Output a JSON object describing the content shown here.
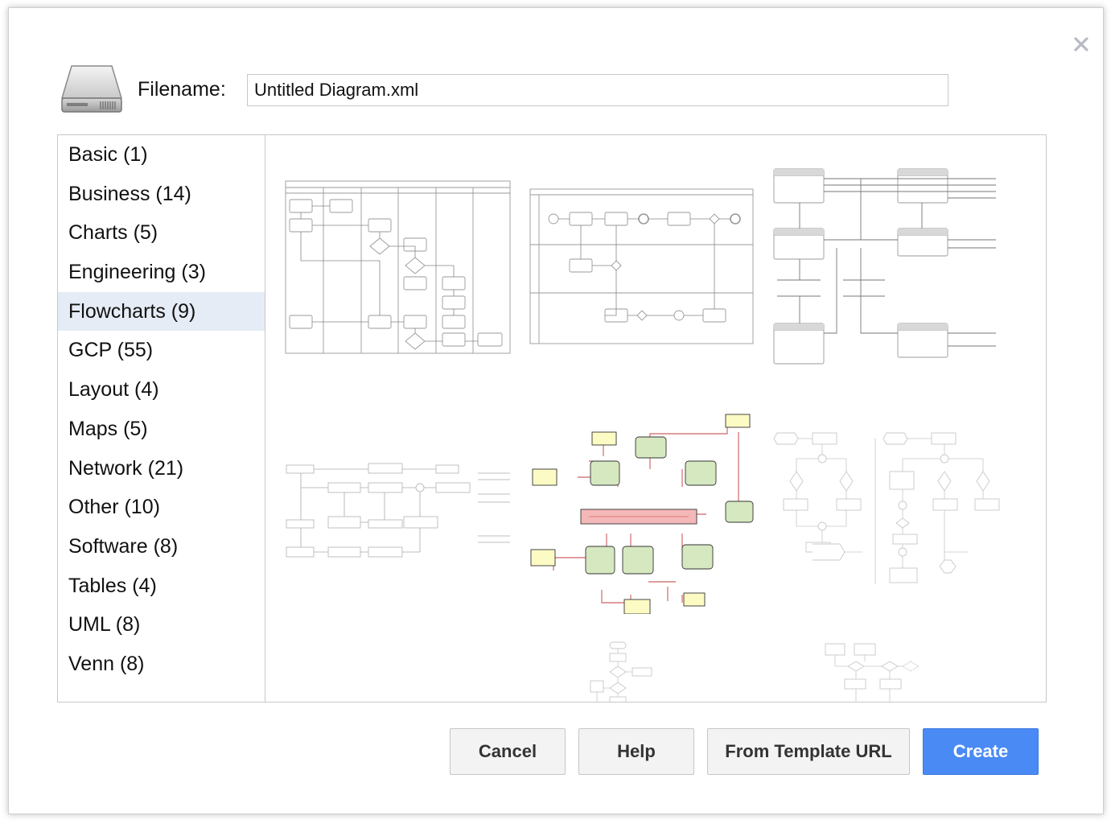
{
  "dialog": {
    "close_icon": "close-icon",
    "drive_icon": "hard-drive-icon",
    "filename_label": "Filename:",
    "filename_value": "Untitled Diagram.xml"
  },
  "categories": [
    {
      "label": "Basic (1)"
    },
    {
      "label": "Business (14)"
    },
    {
      "label": "Charts (5)"
    },
    {
      "label": "Engineering (3)"
    },
    {
      "label": "Flowcharts (9)",
      "selected": true
    },
    {
      "label": "GCP (55)"
    },
    {
      "label": "Layout (4)"
    },
    {
      "label": "Maps (5)"
    },
    {
      "label": "Network (21)"
    },
    {
      "label": "Other (10)"
    },
    {
      "label": "Software (8)"
    },
    {
      "label": "Tables (4)"
    },
    {
      "label": "UML (8)"
    },
    {
      "label": "Venn (8)"
    }
  ],
  "buttons": {
    "cancel": "Cancel",
    "help": "Help",
    "template_url": "From Template URL",
    "create": "Create"
  },
  "colors": {
    "primary_button": "#4a8af4",
    "selected_category": "#e6ecf5",
    "diagram_green": "#d5e8c0",
    "diagram_yellow": "#fdfbc4",
    "diagram_red": "#f5b8b8"
  }
}
